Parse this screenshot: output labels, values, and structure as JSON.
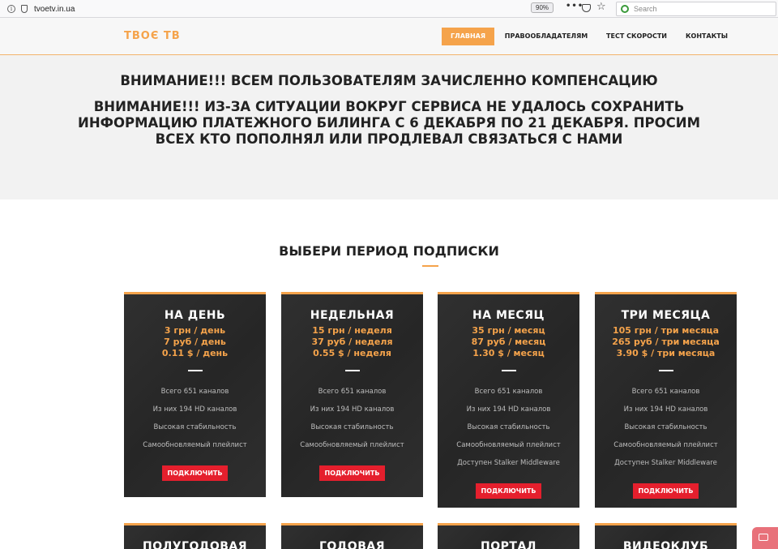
{
  "browser": {
    "url": "tvoetv.in.ua",
    "zoom": "90%",
    "search_placeholder": "Search",
    "dots": "•••",
    "star": "☆"
  },
  "header": {
    "logo": "ТВОЄ ТВ",
    "nav": [
      {
        "label": "ГЛАВНАЯ",
        "active": true
      },
      {
        "label": "ПРАВООБЛАДАТЕЛЯМ",
        "active": false
      },
      {
        "label": "ТЕСТ СКОРОСТИ",
        "active": false
      },
      {
        "label": "КОНТАКТЫ",
        "active": false
      }
    ]
  },
  "notice": {
    "line1": "ВНИМАНИЕ!!! ВСЕМ ПОЛЬЗОВАТЕЛЯМ ЗАЧИСЛЕННО КОМПЕНСАЦИЮ",
    "line2a": "ВНИМАНИЕ!!! ИЗ-ЗА СИТУАЦИИ ВОКРУГ СЕРВИСА НЕ УДАЛОСЬ СОХРАНИТЬ",
    "line2b": "ИНФОРМАЦИЮ ПЛАТЕЖНОГО БИЛИНГА С 6 ДЕКАБРЯ ПО 21 ДЕКАБРЯ. ПРОСИМ",
    "line2c": "ВСЕХ КТО ПОПОЛНЯЛ ИЛИ ПРОДЛЕВАЛ СВЯЗАТЬСЯ С НАМИ"
  },
  "section_title": "ВЫБЕРИ ПЕРИОД ПОДПИСКИ",
  "cards": [
    {
      "title": "НА ДЕНЬ",
      "prices": [
        "3 грн / день",
        "7 руб / день",
        "0.11 $ / день"
      ],
      "features": [
        "Всего 651 каналов",
        "Из них 194 HD каналов",
        "Высокая стабильность",
        "Самообновляемый плейлист"
      ],
      "button": "ПОДКЛЮЧИТЬ"
    },
    {
      "title": "НЕДЕЛЬНАЯ",
      "prices": [
        "15 грн / неделя",
        "37 руб / неделя",
        "0.55 $ / неделя"
      ],
      "features": [
        "Всего 651 каналов",
        "Из них 194 HD каналов",
        "Высокая стабильность",
        "Самообновляемый плейлист"
      ],
      "button": "ПОДКЛЮЧИТЬ"
    },
    {
      "title": "НА МЕСЯЦ",
      "prices": [
        "35 грн / месяц",
        "87 руб / месяц",
        "1.30 $ / месяц"
      ],
      "features": [
        "Всего 651 каналов",
        "Из них 194 HD каналов",
        "Высокая стабильность",
        "Самообновляемый плейлист",
        "Доступен Stalker Middleware"
      ],
      "button": "ПОДКЛЮЧИТЬ"
    },
    {
      "title": "ТРИ МЕСЯЦА",
      "prices": [
        "105 грн / три месяца",
        "265 руб / три месяца",
        "3.90 $ / три месяца"
      ],
      "features": [
        "Всего 651 каналов",
        "Из них 194 HD каналов",
        "Высокая стабильность",
        "Самообновляемый плейлист",
        "Доступен Stalker Middleware"
      ],
      "button": "ПОДКЛЮЧИТЬ"
    }
  ],
  "cards_bottom": [
    {
      "title": "ПОЛУГОДОВАЯ"
    },
    {
      "title": "ГОДОВАЯ"
    },
    {
      "title": "ПОРТАЛ"
    },
    {
      "title": "ВИДЕОКЛУБ"
    }
  ]
}
